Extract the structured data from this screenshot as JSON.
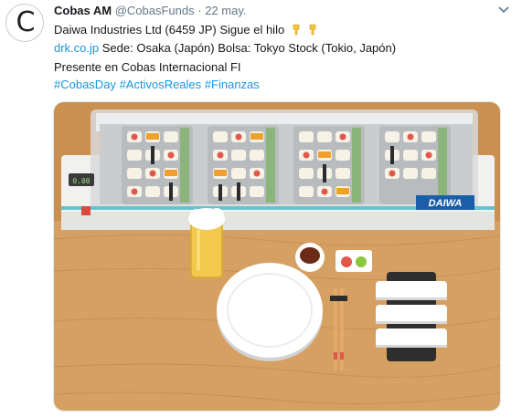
{
  "tweet": {
    "author_name": "Cobas AM",
    "handle": "@CobasFunds",
    "separator": "·",
    "date": "22 may.",
    "avatar_letter": "C",
    "line1_text": "Daiwa Industries Ltd (6459 JP) Sigue el hilo",
    "line1_emoji": "backhand-index-pointing-down",
    "line2_link": "drk.co.jp",
    "line2_text": " Sede: Osaka (Japón) Bolsa: Tokyo Stock (Tokio, Japón)",
    "line3_text": "Presente en Cobas Internacional FI",
    "hashtags": [
      "#CobasDay",
      "#ActivosReales",
      "#Finanzas"
    ],
    "colors": {
      "link": "#1b95e0",
      "muted": "#657786",
      "text": "#14171a"
    }
  },
  "media": {
    "machine_brand": "DAIWA",
    "display_text": "0.00"
  }
}
